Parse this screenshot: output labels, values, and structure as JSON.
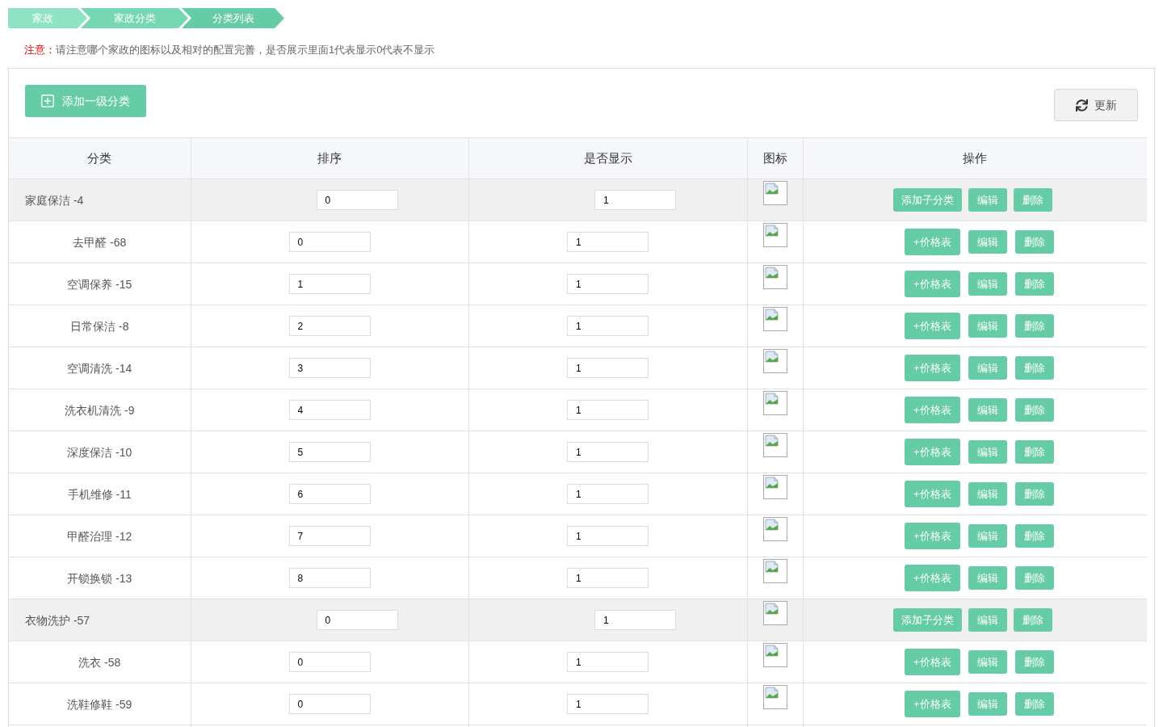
{
  "breadcrumb": [
    "家政",
    "家政分类",
    "分类列表"
  ],
  "notice": {
    "label": "注意：",
    "text": "请注意哪个家政的图标以及相对的配置完善，是否展示里面1代表显示0代表不显示"
  },
  "toolbar": {
    "add_button": "添加一级分类",
    "refresh_button": "更新"
  },
  "table": {
    "columns": [
      "分类",
      "排序",
      "是否显示",
      "图标",
      "操作"
    ],
    "rows": [
      {
        "name": "家庭保洁 -4",
        "sort": "0",
        "show": "1",
        "actions": [
          "添加子分类",
          "编辑",
          "删除"
        ],
        "children": [
          {
            "name": "去甲醛 -68",
            "sort": "0",
            "show": "1",
            "actions": [
              "+价格表",
              "编辑",
              "删除"
            ]
          },
          {
            "name": "空调保养 -15",
            "sort": "1",
            "show": "1",
            "actions": [
              "+价格表",
              "编辑",
              "删除"
            ]
          },
          {
            "name": "日常保洁 -8",
            "sort": "2",
            "show": "1",
            "actions": [
              "+价格表",
              "编辑",
              "删除"
            ]
          },
          {
            "name": "空调清洗 -14",
            "sort": "3",
            "show": "1",
            "actions": [
              "+价格表",
              "编辑",
              "删除"
            ]
          },
          {
            "name": "洗衣机清洗 -9",
            "sort": "4",
            "show": "1",
            "actions": [
              "+价格表",
              "编辑",
              "删除"
            ]
          },
          {
            "name": "深度保洁 -10",
            "sort": "5",
            "show": "1",
            "actions": [
              "+价格表",
              "编辑",
              "删除"
            ]
          },
          {
            "name": "手机维修 -11",
            "sort": "6",
            "show": "1",
            "actions": [
              "+价格表",
              "编辑",
              "删除"
            ]
          },
          {
            "name": "甲醛治理 -12",
            "sort": "7",
            "show": "1",
            "actions": [
              "+价格表",
              "编辑",
              "删除"
            ]
          },
          {
            "name": "开锁换锁 -13",
            "sort": "8",
            "show": "1",
            "actions": [
              "+价格表",
              "编辑",
              "删除"
            ]
          }
        ]
      },
      {
        "name": "衣物洗护 -57",
        "sort": "0",
        "show": "1",
        "actions": [
          "添加子分类",
          "编辑",
          "删除"
        ],
        "children": [
          {
            "name": "洗衣 -58",
            "sort": "0",
            "show": "1",
            "actions": [
              "+价格表",
              "编辑",
              "删除"
            ]
          },
          {
            "name": "洗鞋修鞋 -59",
            "sort": "0",
            "show": "1",
            "actions": [
              "+价格表",
              "编辑",
              "删除"
            ]
          }
        ]
      }
    ]
  }
}
